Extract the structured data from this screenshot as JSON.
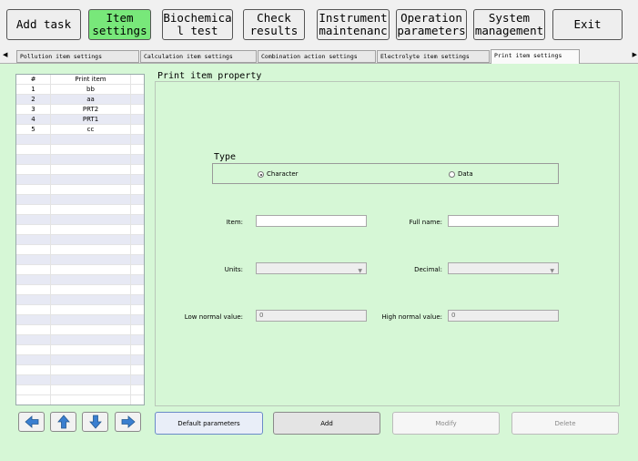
{
  "topbar": {
    "buttons": [
      {
        "label": "Add task"
      },
      {
        "label": "Item\nsettings"
      },
      {
        "label": "Biochemica\nl test"
      },
      {
        "label": "Check\nresults"
      },
      {
        "label": "Instrument\nmaintenanc"
      },
      {
        "label": "Operation\nparameters"
      },
      {
        "label": "System\nmanagement"
      },
      {
        "label": "Exit"
      }
    ]
  },
  "tabs": [
    {
      "label": "Pollution item settings"
    },
    {
      "label": "Calculation item settings"
    },
    {
      "label": "Combination action settings"
    },
    {
      "label": "Electrolyte item settings"
    },
    {
      "label": "Print item settings"
    }
  ],
  "list": {
    "headers": [
      "#",
      "Print item"
    ],
    "rows": [
      {
        "num": "1",
        "name": "bb"
      },
      {
        "num": "2",
        "name": "aa"
      },
      {
        "num": "3",
        "name": "PRT2"
      },
      {
        "num": "4",
        "name": "PRT1"
      },
      {
        "num": "5",
        "name": "cc"
      }
    ]
  },
  "form": {
    "group_title": "Print item property",
    "type_label": "Type",
    "type_options": [
      "Character",
      "Data"
    ],
    "item_label": "Item:",
    "item_value": "",
    "fullname_label": "Full name:",
    "fullname_value": "",
    "units_label": "Units:",
    "units_value": "",
    "decimal_label": "Decimal:",
    "decimal_value": "",
    "low_label": "Low normal value:",
    "low_value": "0",
    "high_label": "High normal value:",
    "high_value": "0"
  },
  "bottom": {
    "default_label": "Default parameters",
    "add_label": "Add",
    "modify_label": "Modify",
    "delete_label": "Delete"
  },
  "colors": {
    "active_button": "#78e87a",
    "panel_bg": "#d6f7d6",
    "list_alt_row": "#e7e9f4",
    "arrow_blue": "#3a7fd0"
  }
}
